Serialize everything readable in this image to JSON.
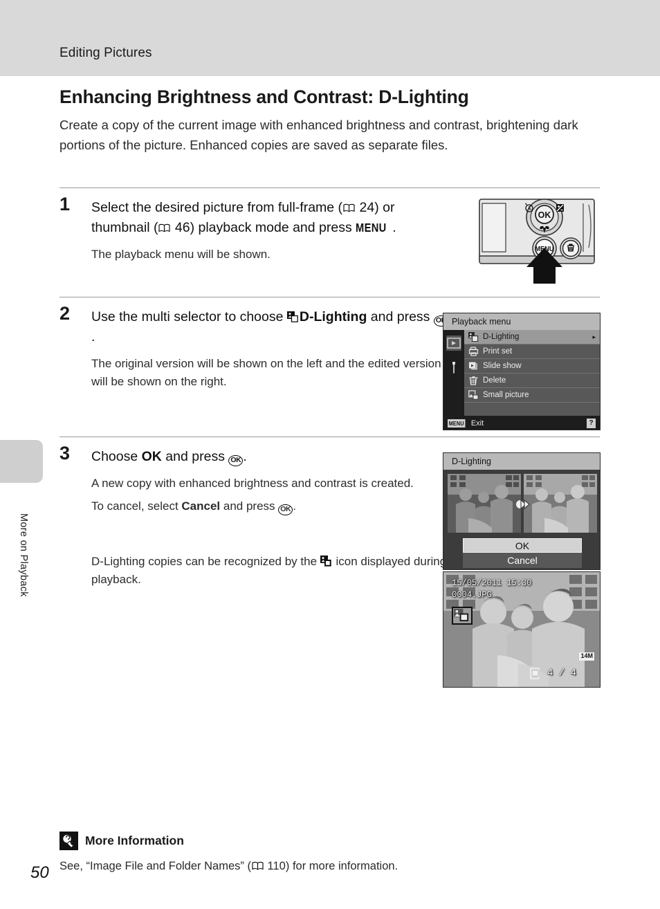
{
  "header": {
    "running_head": "Editing Pictures"
  },
  "side_tab": {
    "label": "More on Playback"
  },
  "page": {
    "number": "50"
  },
  "section": {
    "title": "Enhancing Brightness and Contrast: D-Lighting",
    "intro": "Create a copy of the current image with enhanced brightness and contrast, brightening dark portions of the picture. Enhanced copies are saved as separate files."
  },
  "steps": [
    {
      "number": "1",
      "head_part1": "Select the desired picture from full-frame (",
      "ref1": "24",
      "head_part2": ") or thumbnail (",
      "ref2": "46",
      "head_part3": ") playback mode and press ",
      "menu_glyph": "MENU",
      "head_end": ".",
      "sub": "The playback menu will be shown."
    },
    {
      "number": "2",
      "head_part1": "Use the multi selector to choose ",
      "bold": "D-Lighting",
      "head_part2": " and press ",
      "ok_glyph": "OK",
      "head_end": ".",
      "sub": "The original version will be shown on the left and the edited version will be shown on the right."
    },
    {
      "number": "3",
      "head_part1": "Choose ",
      "bold": "OK",
      "head_part2": " and press ",
      "ok_glyph": "OK",
      "head_end": ".",
      "sub1": "A new copy with enhanced brightness and contrast is created.",
      "sub2_part1": "To cancel, select ",
      "sub2_bold": "Cancel",
      "sub2_part2": " and press ",
      "sub2_end": ".",
      "sub3_part1": "D-Lighting copies can be recognized by the ",
      "sub3_part2": " icon displayed during playback."
    }
  ],
  "camera_figure": {
    "ok_button_label": "OK",
    "menu_button_label": "MENU",
    "icons": [
      "self-timer-icon",
      "exposure-compensation-icon",
      "macro-icon",
      "delete-icon"
    ]
  },
  "playback_menu_screen": {
    "title": "Playback menu",
    "items": [
      {
        "label": "D-Lighting",
        "icon": "d-lighting-icon",
        "selected": true,
        "caret": "▸"
      },
      {
        "label": "Print set",
        "icon": "print-set-icon",
        "selected": false,
        "caret": ""
      },
      {
        "label": "Slide show",
        "icon": "slide-show-icon",
        "selected": false,
        "caret": ""
      },
      {
        "label": "Delete",
        "icon": "delete-icon",
        "selected": false,
        "caret": ""
      },
      {
        "label": "Small picture",
        "icon": "small-picture-icon",
        "selected": false,
        "caret": ""
      }
    ],
    "footer": {
      "badge": "MENU",
      "label": "Exit",
      "help": "?"
    },
    "tabs": [
      "playback-tab-icon",
      "setup-tab-icon"
    ]
  },
  "dlighting_screen": {
    "title": "D-Lighting",
    "ok_label": "OK",
    "cancel_label": "Cancel"
  },
  "playback_screen": {
    "date": "15/05/2011 15:30",
    "filename": "0004.JPG",
    "dlighting_badge": "d-lighting-copy-icon",
    "counter": "4 /  4",
    "image_size": "14M"
  },
  "more_information": {
    "icon": "light-bulb-icon",
    "title": "More Information",
    "text": "See, “Image File and Folder Names” (",
    "ref": "110",
    "text_end": ") for more information."
  },
  "colors": {
    "header_band": "#d9d9d9",
    "side_tab": "#cfcfcf",
    "rule": "#9a9a9a",
    "lcd_bg": "#3c3c3c",
    "lcd_titlebar": "#b8b8b8",
    "menu_selected": "#9a9a9a"
  }
}
